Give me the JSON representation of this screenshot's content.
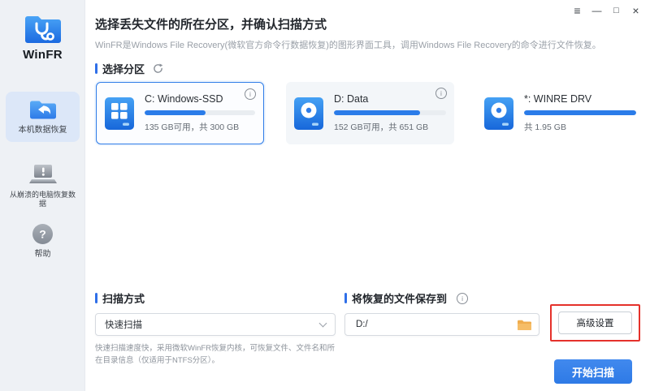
{
  "window": {
    "controls": {
      "menu": "≡",
      "minimize": "—",
      "maximize": "□",
      "close": "×"
    }
  },
  "sidebar": {
    "logo_text": "WinFR",
    "items": [
      {
        "label": "本机数据恢复",
        "icon": "folder-restore-icon",
        "selected": true
      },
      {
        "label": "从崩溃的电脑恢复数据",
        "icon": "crashed-pc-icon",
        "selected": false
      },
      {
        "label": "帮助",
        "icon": "help-icon",
        "selected": false
      }
    ]
  },
  "header": {
    "title": "选择丢失文件的所在分区，并确认扫描方式",
    "subtitle": "WinFR是Windows File Recovery(微软官方命令行数据恢复)的图形界面工具，调用Windows File Recovery的命令进行文件恢复。"
  },
  "partition_section": {
    "title": "选择分区",
    "refresh_icon": "refresh-icon",
    "drives": [
      {
        "name": "C: Windows-SSD",
        "detail": "135 GB可用，共 300 GB",
        "used_percent": 55,
        "icon": "windows-drive-icon",
        "selected": true,
        "has_info": true
      },
      {
        "name": "D: Data",
        "detail": "152 GB可用，共 651 GB",
        "used_percent": 77,
        "icon": "disk-drive-icon",
        "selected": false,
        "has_info": true
      },
      {
        "name": "*: WINRE DRV",
        "detail": "共 1.95 GB",
        "used_percent": 100,
        "icon": "disk-drive-icon",
        "selected": false,
        "has_info": false
      }
    ]
  },
  "scan_section": {
    "title": "扫描方式",
    "selected_mode": "快速扫描",
    "description": "快速扫描速度快，采用微软WinFR恢复内核，可恢复文件、文件名和所在目录信息（仅适用于NTFS分区）。"
  },
  "save_section": {
    "title": "将恢复的文件保存到",
    "path": "D:/",
    "folder_icon": "folder-icon",
    "info_icon": "info-icon"
  },
  "actions": {
    "advanced_label": "高级设置",
    "start_label": "开始扫描"
  },
  "colors": {
    "accent_blue": "#2b7ce9",
    "highlight_red": "#e5312b",
    "folder_orange": "#f0ad4e",
    "sidebar_bg": "#eef1f5",
    "selected_nav_bg": "#dce7f8"
  }
}
